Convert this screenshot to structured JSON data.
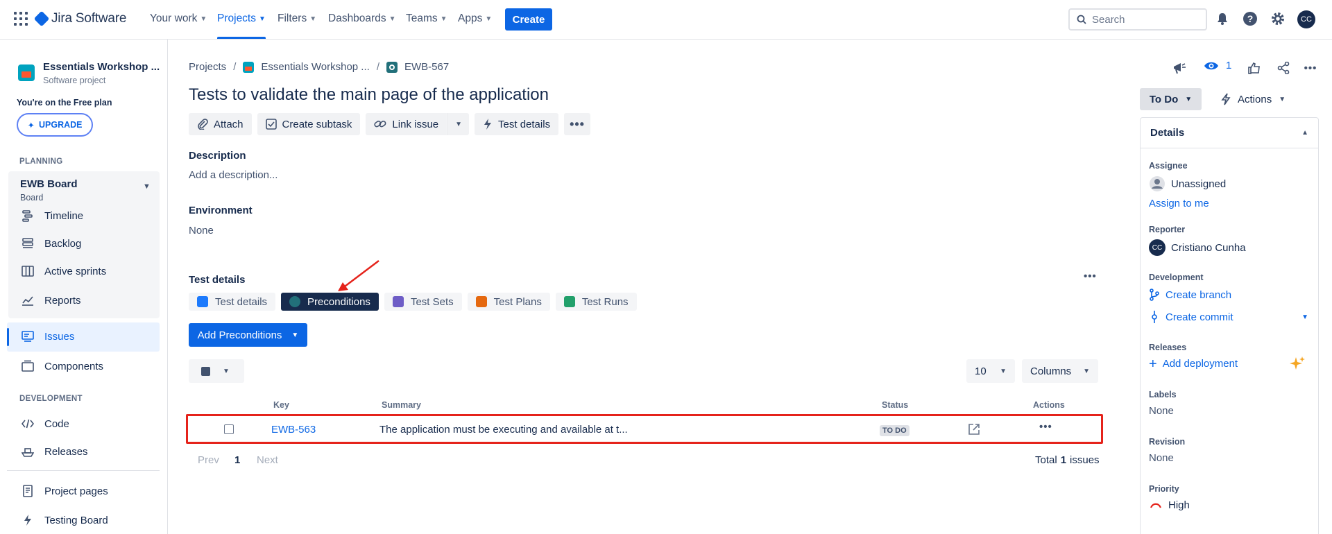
{
  "nav": {
    "logo_text": "Jira Software",
    "items": [
      {
        "label": "Your work"
      },
      {
        "label": "Projects"
      },
      {
        "label": "Filters"
      },
      {
        "label": "Dashboards"
      },
      {
        "label": "Teams"
      },
      {
        "label": "Apps"
      }
    ],
    "create_label": "Create",
    "search_placeholder": "Search",
    "avatar_initials": "CC"
  },
  "sidebar": {
    "project_name": "Essentials Workshop ...",
    "project_type": "Software project",
    "plan_text": "You're on the Free plan",
    "upgrade_label": "UPGRADE",
    "planning_label": "PLANNING",
    "board_title": "EWB Board",
    "board_sub": "Board",
    "planning_items": [
      "Timeline",
      "Backlog",
      "Active sprints",
      "Reports"
    ],
    "issues_label": "Issues",
    "components_label": "Components",
    "development_label": "DEVELOPMENT",
    "dev_items": [
      "Code",
      "Releases"
    ],
    "bottom_items": [
      "Project pages",
      "Testing Board"
    ]
  },
  "main": {
    "breadcrumb": {
      "projects": "Projects",
      "project": "Essentials Workshop ...",
      "issue": "EWB-567"
    },
    "title": "Tests to validate the main page of the application",
    "toolbar": {
      "attach": "Attach",
      "subtask": "Create subtask",
      "link": "Link issue",
      "test_details": "Test details"
    },
    "description_label": "Description",
    "description_placeholder": "Add a description...",
    "environment_label": "Environment",
    "environment_value": "None",
    "test_details_label": "Test details",
    "tabs": [
      "Test details",
      "Preconditions",
      "Test Sets",
      "Test Plans",
      "Test Runs"
    ],
    "active_tab": "Preconditions",
    "add_preconditions_label": "Add Preconditions",
    "page_size": "10",
    "columns_label": "Columns",
    "table": {
      "headers": {
        "key": "Key",
        "summary": "Summary",
        "status": "Status",
        "actions": "Actions"
      },
      "rows": [
        {
          "key": "EWB-563",
          "summary": "The application must be executing and available at t...",
          "status": "TO DO"
        }
      ]
    },
    "pager": {
      "prev": "Prev",
      "page": "1",
      "next": "Next",
      "total_prefix": "Total",
      "total_count": "1",
      "total_suffix": "issues"
    }
  },
  "right": {
    "watch_count": "1",
    "status_label": "To Do",
    "actions_label": "Actions",
    "details_label": "Details",
    "assignee_label": "Assignee",
    "assignee_value": "Unassigned",
    "assign_to_me": "Assign to me",
    "reporter_label": "Reporter",
    "reporter_initials": "CC",
    "reporter_value": "Cristiano Cunha",
    "development_label": "Development",
    "create_branch": "Create branch",
    "create_commit": "Create commit",
    "releases_label": "Releases",
    "add_deployment": "Add deployment",
    "labels_label": "Labels",
    "labels_value": "None",
    "revision_label": "Revision",
    "revision_value": "None",
    "priority_label": "Priority",
    "priority_value": "High"
  },
  "colors": {
    "brand_blue": "#0c66e4",
    "highlight_red": "#e5231b",
    "dark_navy": "#172b4d"
  }
}
